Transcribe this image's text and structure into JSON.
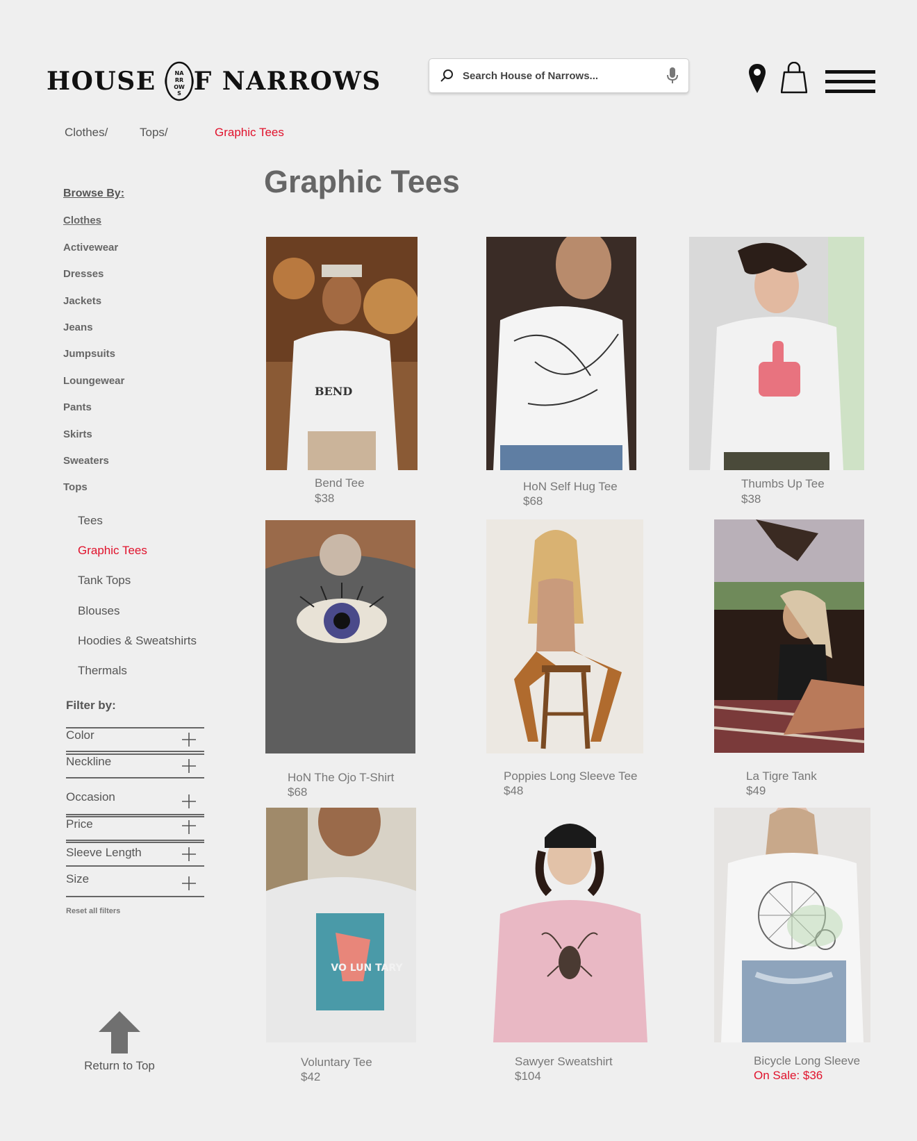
{
  "brand": {
    "left_word": "HOUSE",
    "right_word": "F NARROWS",
    "emblem_text": "NARROWS"
  },
  "search": {
    "placeholder": "Search House of Narrows..."
  },
  "header_icons": [
    "location-pin-icon",
    "shopping-bag-icon",
    "hamburger-menu-icon"
  ],
  "breadcrumb": [
    {
      "label": "Clothes/"
    },
    {
      "label": "Tops/"
    },
    {
      "label": "Graphic Tees"
    }
  ],
  "page_title": "Graphic Tees",
  "sidebar": {
    "browse_label": "Browse By:",
    "clothes_label": "Clothes",
    "categories": [
      "Activewear",
      "Dresses",
      "Jackets",
      "Jeans",
      "Jumpsuits",
      "Loungewear",
      "Pants",
      "Skirts",
      "Sweaters",
      "Tops"
    ],
    "tops_sub": [
      "Tees",
      "Graphic Tees",
      "Tank Tops",
      "Blouses",
      "Hoodies & Sweatshirts",
      "Thermals"
    ],
    "filter_label": "Filter by:",
    "filters": [
      "Color",
      "Neckline",
      "Occasion",
      "Price",
      "Sleeve Length",
      "Size"
    ],
    "reset_label": "Reset all filters"
  },
  "return_to_top": "Return to Top",
  "products": [
    {
      "name": "Bend Tee",
      "price": "$38",
      "graphic": "BEND"
    },
    {
      "name": "HoN Self Hug Tee",
      "price": "$68"
    },
    {
      "name": "Thumbs Up Tee",
      "price": "$38"
    },
    {
      "name": "HoN The Ojo T-Shirt",
      "price": "$68"
    },
    {
      "name": "Poppies Long Sleeve Tee",
      "price": "$48"
    },
    {
      "name": "La Tigre Tank",
      "price": "$49"
    },
    {
      "name": "Voluntary Tee",
      "price": "$42",
      "graphic": "VO LUN TARY"
    },
    {
      "name": "Sawyer Sweatshirt",
      "price": "$104"
    },
    {
      "name": "Bicycle Long Sleeve",
      "price": "On Sale: $36"
    }
  ],
  "colors": {
    "accent": "#e0112b",
    "text": "#555555",
    "background": "#efefef"
  }
}
